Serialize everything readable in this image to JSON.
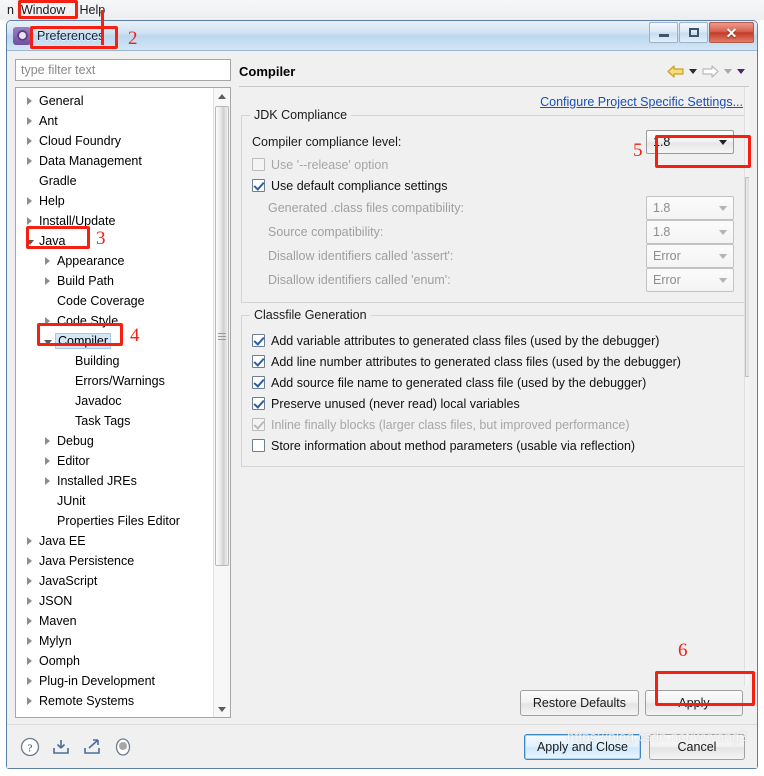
{
  "menubar": {
    "items": [
      {
        "label": "n"
      },
      {
        "label": "Window"
      },
      {
        "label": "Help"
      }
    ]
  },
  "dialog": {
    "title": "Preferences",
    "icon": "eclipse-preferences-icon",
    "window_buttons": {
      "minimize": "minimize-button",
      "maximize": "maximize-button",
      "close": "close-button"
    }
  },
  "filter": {
    "placeholder": "type filter text",
    "value": ""
  },
  "tree": {
    "items": [
      {
        "label": "General",
        "level": 1,
        "state": "collapsed"
      },
      {
        "label": "Ant",
        "level": 1,
        "state": "collapsed"
      },
      {
        "label": "Cloud Foundry",
        "level": 1,
        "state": "collapsed"
      },
      {
        "label": "Data Management",
        "level": 1,
        "state": "collapsed"
      },
      {
        "label": "Gradle",
        "level": 1,
        "state": "leaf"
      },
      {
        "label": "Help",
        "level": 1,
        "state": "collapsed"
      },
      {
        "label": "Install/Update",
        "level": 1,
        "state": "collapsed"
      },
      {
        "label": "Java",
        "level": 1,
        "state": "expanded"
      },
      {
        "label": "Appearance",
        "level": 2,
        "state": "collapsed"
      },
      {
        "label": "Build Path",
        "level": 2,
        "state": "collapsed"
      },
      {
        "label": "Code Coverage",
        "level": 2,
        "state": "leaf"
      },
      {
        "label": "Code Style",
        "level": 2,
        "state": "collapsed"
      },
      {
        "label": "Compiler",
        "level": 2,
        "state": "expanded",
        "selected": true
      },
      {
        "label": "Building",
        "level": 3,
        "state": "leaf"
      },
      {
        "label": "Errors/Warnings",
        "level": 3,
        "state": "leaf"
      },
      {
        "label": "Javadoc",
        "level": 3,
        "state": "leaf"
      },
      {
        "label": "Task Tags",
        "level": 3,
        "state": "leaf"
      },
      {
        "label": "Debug",
        "level": 2,
        "state": "collapsed"
      },
      {
        "label": "Editor",
        "level": 2,
        "state": "collapsed"
      },
      {
        "label": "Installed JREs",
        "level": 2,
        "state": "collapsed"
      },
      {
        "label": "JUnit",
        "level": 2,
        "state": "leaf"
      },
      {
        "label": "Properties Files Editor",
        "level": 2,
        "state": "leaf"
      },
      {
        "label": "Java EE",
        "level": 1,
        "state": "collapsed"
      },
      {
        "label": "Java Persistence",
        "level": 1,
        "state": "collapsed"
      },
      {
        "label": "JavaScript",
        "level": 1,
        "state": "collapsed"
      },
      {
        "label": "JSON",
        "level": 1,
        "state": "collapsed"
      },
      {
        "label": "Maven",
        "level": 1,
        "state": "collapsed"
      },
      {
        "label": "Mylyn",
        "level": 1,
        "state": "collapsed"
      },
      {
        "label": "Oomph",
        "level": 1,
        "state": "collapsed"
      },
      {
        "label": "Plug-in Development",
        "level": 1,
        "state": "collapsed"
      },
      {
        "label": "Remote Systems",
        "level": 1,
        "state": "collapsed"
      }
    ]
  },
  "panel": {
    "title": "Compiler",
    "nav": {
      "back": "back-arrow-icon",
      "back_menu": "back-dropdown-icon",
      "forward": "forward-arrow-icon",
      "forward_menu": "forward-dropdown-icon",
      "view_menu": "view-menu-icon"
    },
    "configure_link": "Configure Project Specific Settings...",
    "jdk_group": {
      "title": "JDK Compliance",
      "compliance_label": "Compiler compliance level:",
      "compliance_value": "1.8",
      "use_release_label": "Use '--release' option",
      "use_release_checked": false,
      "use_release_enabled": false,
      "use_defaults_label": "Use default compliance settings",
      "use_defaults_checked": true,
      "rows": [
        {
          "label": "Generated .class files compatibility:",
          "value": "1.8",
          "enabled": false
        },
        {
          "label": "Source compatibility:",
          "value": "1.8",
          "enabled": false
        },
        {
          "label": "Disallow identifiers called 'assert':",
          "value": "Error",
          "enabled": false
        },
        {
          "label": "Disallow identifiers called 'enum':",
          "value": "Error",
          "enabled": false
        }
      ]
    },
    "classfile_group": {
      "title": "Classfile Generation",
      "options": [
        {
          "label": "Add variable attributes to generated class files (used by the debugger)",
          "checked": true,
          "enabled": true
        },
        {
          "label": "Add line number attributes to generated class files (used by the debugger)",
          "checked": true,
          "enabled": true
        },
        {
          "label": "Add source file name to generated class file (used by the debugger)",
          "checked": true,
          "enabled": true
        },
        {
          "label": "Preserve unused (never read) local variables",
          "checked": true,
          "enabled": true
        },
        {
          "label": "Inline finally blocks (larger class files, but improved performance)",
          "checked": true,
          "enabled": false
        },
        {
          "label": "Store information about method parameters (usable via reflection)",
          "checked": false,
          "enabled": true
        }
      ]
    },
    "restore_defaults_label": "Restore Defaults",
    "apply_label": "Apply"
  },
  "footer": {
    "icons": [
      {
        "name": "help-icon"
      },
      {
        "name": "import-icon"
      },
      {
        "name": "export-icon"
      },
      {
        "name": "oomph-icon"
      }
    ],
    "apply_and_close_label": "Apply and Close",
    "cancel_label": "Cancel"
  },
  "annotations": {
    "numbers": [
      "2",
      "3",
      "4",
      "5",
      "6"
    ],
    "color": "#f51f12"
  },
  "watermark": "https://blog.csdn.net/wyyang2"
}
